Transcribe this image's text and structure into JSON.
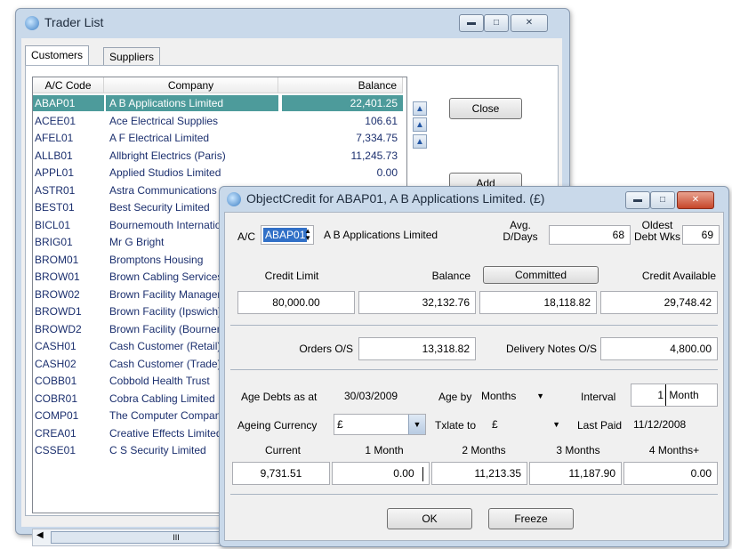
{
  "trader_window": {
    "title": "Trader List",
    "tabs": [
      "Customers",
      "Suppliers"
    ],
    "columns": {
      "code": "A/C Code",
      "company": "Company",
      "balance": "Balance"
    },
    "rows": [
      {
        "code": "ABAP01",
        "company": "A B Applications Limited",
        "balance": "22,401.25"
      },
      {
        "code": "ACEE01",
        "company": "Ace Electrical Supplies",
        "balance": "106.61"
      },
      {
        "code": "AFEL01",
        "company": "A F Electrical Limited",
        "balance": "7,334.75"
      },
      {
        "code": "ALLB01",
        "company": "Allbright Electrics (Paris)",
        "balance": "11,245.73"
      },
      {
        "code": "APPL01",
        "company": "Applied Studios Limited",
        "balance": "0.00"
      },
      {
        "code": "ASTR01",
        "company": "Astra Communications",
        "balance": ""
      },
      {
        "code": "BEST01",
        "company": "Best Security Limited",
        "balance": ""
      },
      {
        "code": "BICL01",
        "company": "Bournemouth International",
        "balance": ""
      },
      {
        "code": "BRIG01",
        "company": "Mr G Bright",
        "balance": ""
      },
      {
        "code": "BROM01",
        "company": "Bromptons Housing",
        "balance": ""
      },
      {
        "code": "BROW01",
        "company": "Brown Cabling Services",
        "balance": ""
      },
      {
        "code": "BROW02",
        "company": "Brown Facility Management",
        "balance": ""
      },
      {
        "code": "BROWD1",
        "company": "Brown Facility (Ipswich)",
        "balance": ""
      },
      {
        "code": "BROWD2",
        "company": "Brown Facility (Bournemouth)",
        "balance": ""
      },
      {
        "code": "CASH01",
        "company": "Cash Customer (Retail)",
        "balance": ""
      },
      {
        "code": "CASH02",
        "company": "Cash Customer (Trade)",
        "balance": ""
      },
      {
        "code": "COBB01",
        "company": "Cobbold Health Trust",
        "balance": ""
      },
      {
        "code": "COBR01",
        "company": "Cobra Cabling Limited",
        "balance": ""
      },
      {
        "code": "COMP01",
        "company": "The Computer Company",
        "balance": ""
      },
      {
        "code": "CREA01",
        "company": "Creative Effects Limited",
        "balance": ""
      },
      {
        "code": "CSSE01",
        "company": "C S Security Limited",
        "balance": ""
      }
    ],
    "buttons": {
      "close": "Close",
      "add": "Add"
    },
    "hscroll_thumb": "III",
    "selected_row_color": "#4d9b9b"
  },
  "credit_window": {
    "title": "ObjectCredit for ABAP01, A B Applications Limited. (£)",
    "ac_label": "A/C",
    "ac_value": "ABAP01",
    "company_name": "A B Applications Limited",
    "avg_label_1": "Avg.",
    "avg_label_2": "D/Days",
    "avg_value": "68",
    "oldest_label_1": "Oldest",
    "oldest_label_2": "Debt Wks",
    "oldest_value": "69",
    "credit_limit_label": "Credit Limit",
    "balance_label": "Balance",
    "committed_label": "Committed",
    "credit_available_label": "Credit Available",
    "credit_limit": "80,000.00",
    "balance": "32,132.76",
    "committed": "18,118.82",
    "credit_available": "29,748.42",
    "orders_os_label": "Orders O/S",
    "orders_os": "13,318.82",
    "delivery_notes_label": "Delivery Notes O/S",
    "delivery_notes": "4,800.00",
    "age_debts_label": "Age Debts as at",
    "age_debts_date": "30/03/2009",
    "age_by_label": "Age by",
    "age_by_value": "Months",
    "interval_label": "Interval",
    "interval_value": "1",
    "interval_unit": "Month",
    "ageing_currency_label": "Ageing Currency",
    "ageing_currency_value": "£",
    "txlate_label": "Txlate to",
    "txlate_value": "£",
    "last_paid_label": "Last Paid",
    "last_paid_value": "11/12/2008",
    "aged_headers": [
      "Current",
      "1 Month",
      "2 Months",
      "3 Months",
      "4 Months+"
    ],
    "aged_values": [
      "9,731.51",
      "0.00",
      "11,213.35",
      "11,187.90",
      "0.00"
    ],
    "ok_label": "OK",
    "freeze_label": "Freeze"
  },
  "icons": {
    "minimize": "minimize-icon",
    "maximize": "maximize-icon",
    "close": "close-icon"
  }
}
